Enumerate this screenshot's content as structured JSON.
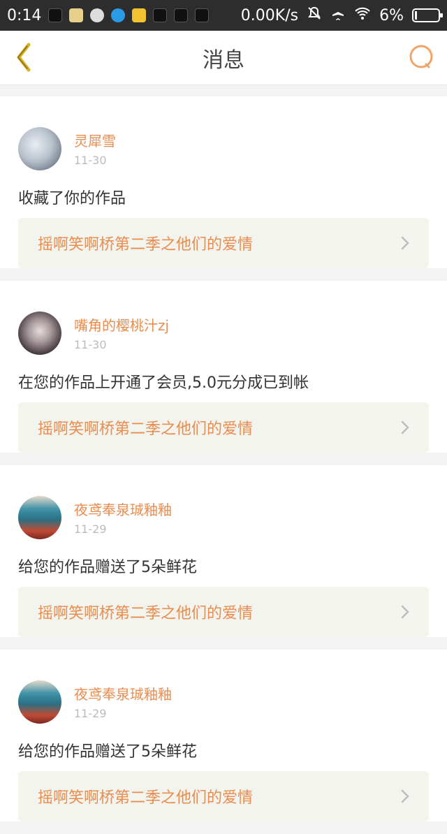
{
  "status_bar": {
    "time": "0:14",
    "net_speed": "0.00K/s",
    "battery": "6%",
    "notif_icons": [
      "tiktok-icon",
      "sticker-icon",
      "chat-icon",
      "blue-app-icon",
      "weibo-icon",
      "tiktok-icon",
      "tiktok-icon",
      "tiktok-icon"
    ]
  },
  "header": {
    "title": "消息"
  },
  "messages": [
    {
      "name": "灵犀雪",
      "date": "11-30",
      "action": "收藏了你的作品",
      "work": "摇啊笑啊桥第二季之他们的爱情"
    },
    {
      "name": "嘴角的樱桃汁zj",
      "date": "11-30",
      "action": "在您的作品上开通了会员,5.0元分成已到帐",
      "work": "摇啊笑啊桥第二季之他们的爱情"
    },
    {
      "name": "夜鸢奉泉珹釉釉",
      "date": "11-29",
      "action": "给您的作品赠送了5朵鲜花",
      "work": "摇啊笑啊桥第二季之他们的爱情"
    },
    {
      "name": "夜鸢奉泉珹釉釉",
      "date": "11-29",
      "action": "给您的作品赠送了5朵鲜花",
      "work": "摇啊笑啊桥第二季之他们的爱情"
    }
  ],
  "colors": {
    "accent": "#e98c4e",
    "status_bar_bg": "#2d2d2d",
    "card_bg": "#ffffff",
    "work_bg": "#f4f4ee"
  }
}
